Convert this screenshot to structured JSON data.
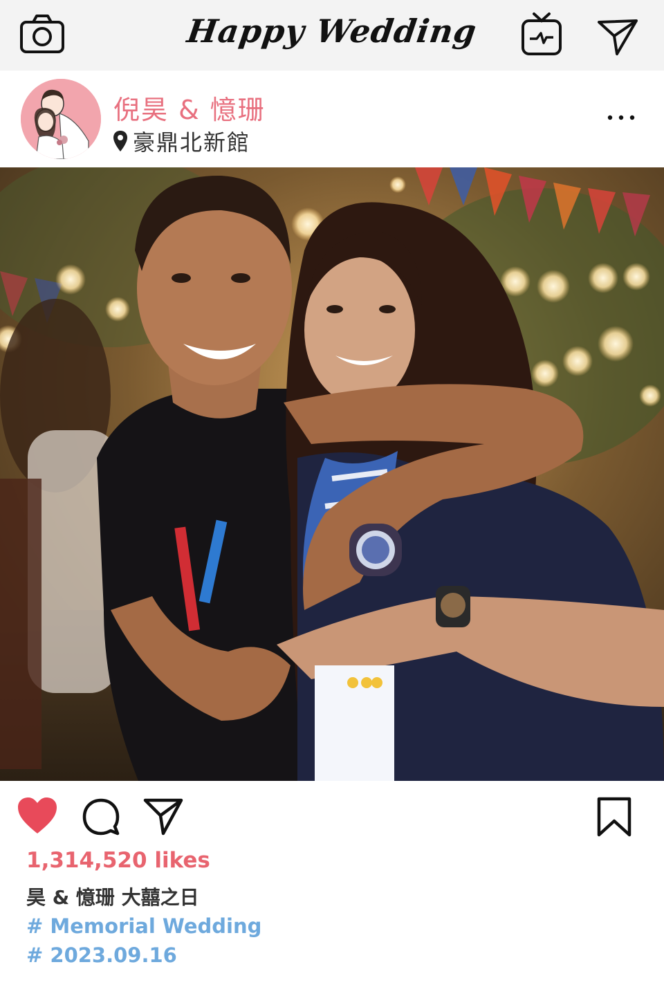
{
  "topbar": {
    "title": "Happy Wedding",
    "icons": [
      "camera-icon",
      "igtv-icon",
      "send-icon"
    ]
  },
  "post": {
    "username": "倪昊 & 憶珊",
    "location": "豪鼎北新館",
    "likes": "1,314,520 likes",
    "caption": "昊 & 憶珊 大囍之日",
    "hashtags": [
      "# Memorial Wedding",
      "# 2023.09.16"
    ],
    "liked": true
  },
  "colors": {
    "accent_pink": "#e8646f",
    "hashtag_blue": "#6ea9dd",
    "topbar_bg": "#f3f3f3",
    "avatar_bg": "#f2a5ad"
  }
}
